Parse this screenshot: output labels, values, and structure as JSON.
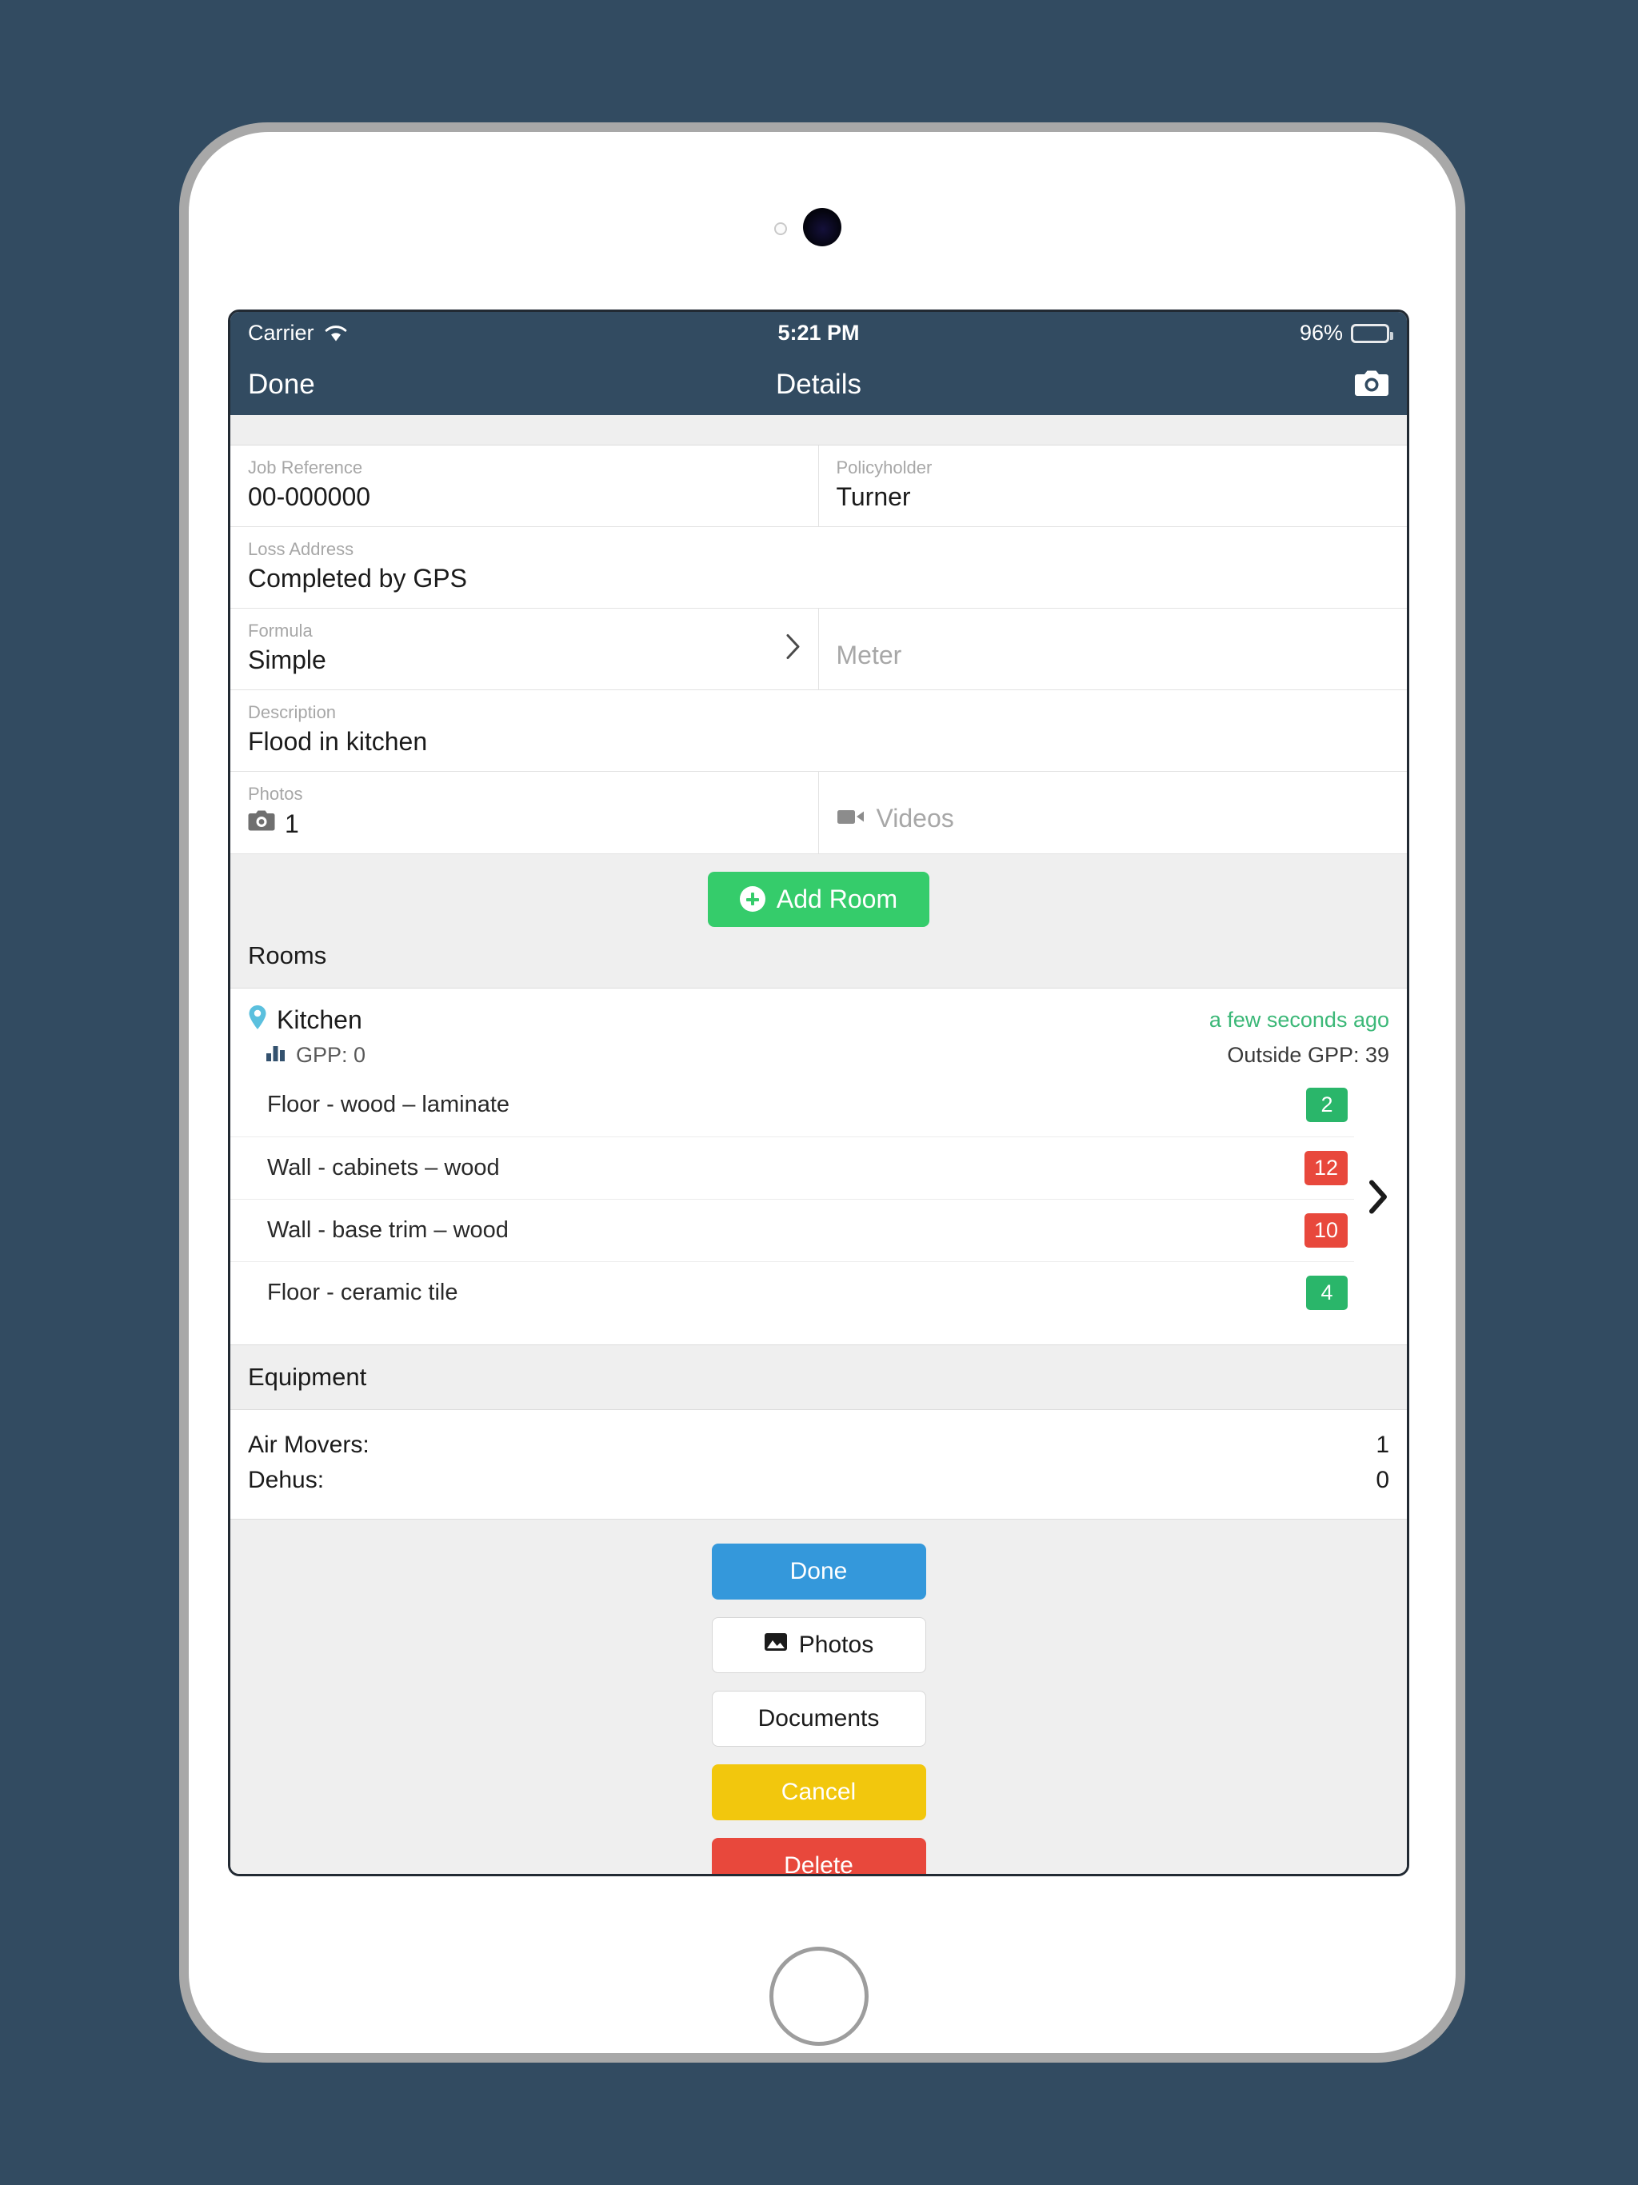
{
  "status_bar": {
    "carrier": "Carrier",
    "wifi_icon": "wifi-icon",
    "time": "5:21 PM",
    "battery_percent": "96%",
    "battery_icon": "battery-icon"
  },
  "nav_bar": {
    "left_button": "Done",
    "title": "Details",
    "right_icon": "camera-icon"
  },
  "form": {
    "job_reference": {
      "label": "Job Reference",
      "value": "00-000000"
    },
    "policyholder": {
      "label": "Policyholder",
      "value": "Turner"
    },
    "loss_address": {
      "label": "Loss Address",
      "value": "Completed by GPS"
    },
    "formula": {
      "label": "Formula",
      "value": "Simple",
      "chevron_icon": "chevron-right-icon"
    },
    "meter": {
      "placeholder": "Meter"
    },
    "description": {
      "label": "Description",
      "value": "Flood in kitchen"
    },
    "photos": {
      "label": "Photos",
      "value": "1",
      "icon": "camera-icon"
    },
    "videos": {
      "placeholder": "Videos",
      "icon": "video-camera-icon"
    }
  },
  "rooms_section": {
    "add_room_label": "Add Room",
    "add_room_icon": "plus-circle-icon",
    "heading": "Rooms",
    "rooms": [
      {
        "name": "Kitchen",
        "pin_icon": "location-pin-icon",
        "updated": "a few seconds ago",
        "gpp_label": "GPP: 0",
        "gpp_icon": "bar-chart-icon",
        "outside_gpp": "Outside GPP: 39",
        "chevron_icon": "chevron-right-icon",
        "items": [
          {
            "label": "Floor - wood – laminate",
            "badge": "2",
            "badge_color": "green"
          },
          {
            "label": "Wall - cabinets – wood",
            "badge": "12",
            "badge_color": "red"
          },
          {
            "label": "Wall - base trim – wood",
            "badge": "10",
            "badge_color": "red"
          },
          {
            "label": "Floor - ceramic tile",
            "badge": "4",
            "badge_color": "green"
          }
        ]
      }
    ]
  },
  "equipment": {
    "heading": "Equipment",
    "rows": [
      {
        "label": "Air Movers:",
        "value": "1"
      },
      {
        "label": "Dehus:",
        "value": "0"
      }
    ]
  },
  "actions": {
    "done": "Done",
    "photos": "Photos",
    "photos_icon": "image-icon",
    "documents": "Documents",
    "cancel": "Cancel",
    "delete": "Delete"
  },
  "colors": {
    "navbar": "#324b61",
    "page_background": "#324b61",
    "accent_green": "#35cc6b",
    "badge_green": "#2ab66a",
    "badge_red": "#e8483c",
    "done_blue": "#3498db",
    "cancel_yellow": "#f2c70d",
    "delete_red": "#e8483c",
    "updated_green": "#3cb878",
    "pin_blue": "#5bc0de"
  }
}
